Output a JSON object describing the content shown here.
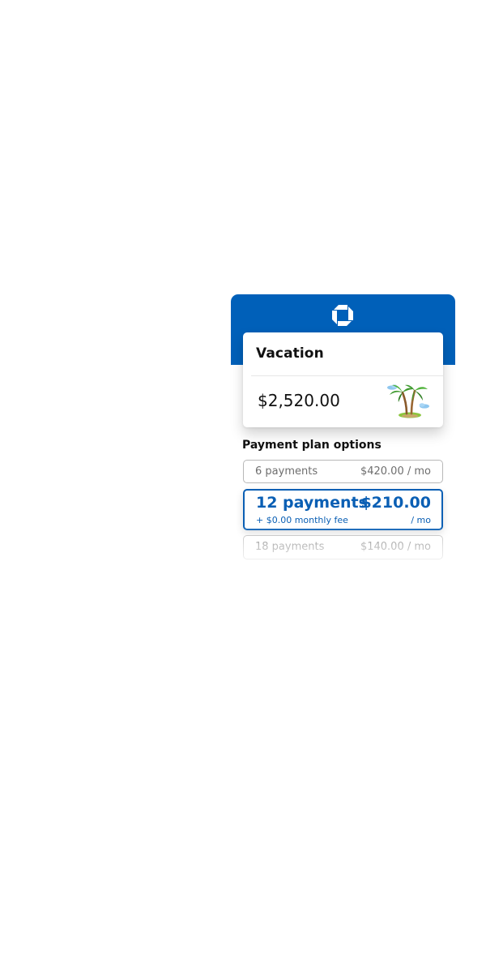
{
  "brand": {
    "logo_icon": "octagon-logo-icon",
    "header_color": "#0060b9"
  },
  "purchase": {
    "title": "Vacation",
    "amount": "$2,520.00",
    "illustration_icon": "palm-tree-icon"
  },
  "payment_plans": {
    "heading": "Payment plan options",
    "accent_color": "#0a5fb4",
    "options": [
      {
        "count": "6 payments",
        "amount": "$420.00 / mo",
        "selected": false
      },
      {
        "count": "12 payments",
        "fee": "+ $0.00 monthly fee",
        "amount": "$210.00",
        "per": "/ mo",
        "selected": true
      },
      {
        "count": "18 payments",
        "amount": "$140.00 / mo",
        "selected": false
      }
    ]
  }
}
